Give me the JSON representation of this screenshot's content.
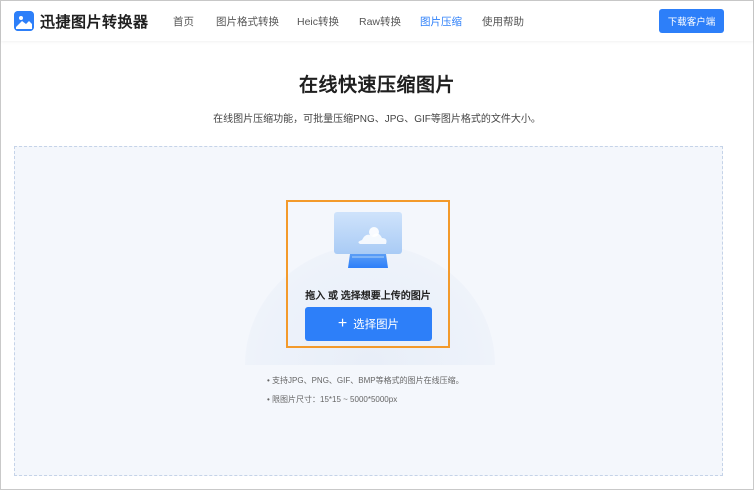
{
  "header": {
    "logo_text": "迅捷图片转换器",
    "nav": [
      {
        "label": "首页"
      },
      {
        "label": "图片格式转换"
      },
      {
        "label": "Heic转换"
      },
      {
        "label": "Raw转换"
      },
      {
        "label": "图片压缩"
      },
      {
        "label": "使用帮助"
      }
    ],
    "active_nav": "图片压缩",
    "download_label": "下载客户端"
  },
  "main": {
    "title": "在线快速压缩图片",
    "subtitle": "在线图片压缩功能，可批量压缩PNG、JPG、GIF等图片格式的文件大小。",
    "drop_hint": "拖入 或 选择想要上传的图片",
    "select_button_label": "选择图片",
    "notes": [
      "• 支持JPG、PNG、GIF、BMP等格式的图片在线压缩。",
      "• 限图片尺寸：15*15 ~ 5000*5000px"
    ]
  },
  "colors": {
    "accent": "#2d7ff9",
    "highlight": "#f39a2b",
    "drop_bg": "#f4f7fc"
  },
  "icons": {
    "logo": "image-icon",
    "upload": "image-upload-illustration",
    "plus": "plus-icon"
  }
}
